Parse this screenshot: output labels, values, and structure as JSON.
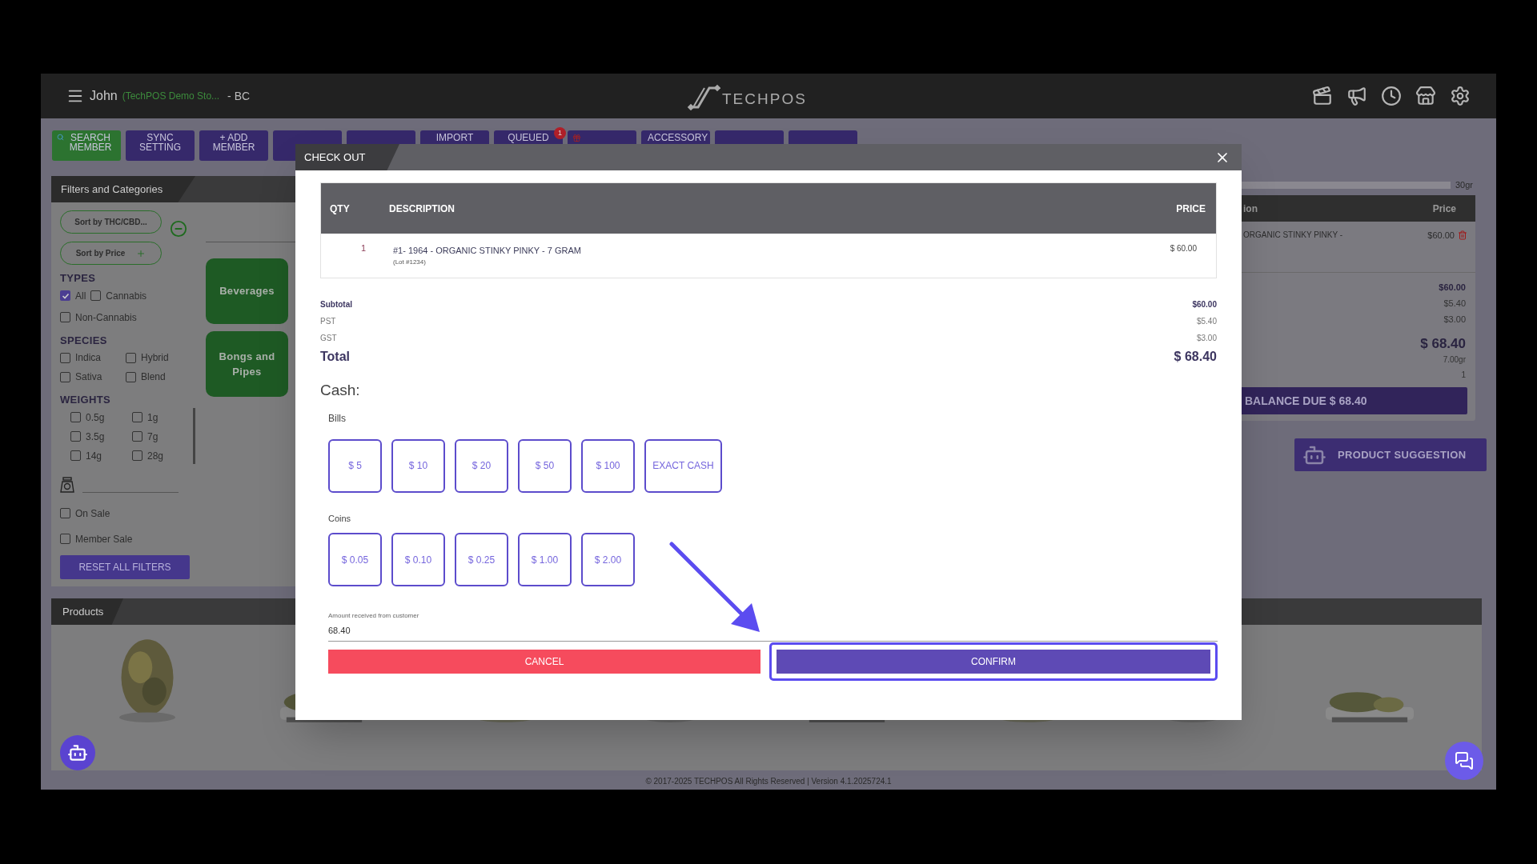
{
  "top_bar": {
    "user": "John",
    "store": "(TechPOS Demo Sto...",
    "region": "- BC",
    "logo": "TECHPOS"
  },
  "toolbar": [
    {
      "label": "SEARCH MEMBER",
      "kind": "search"
    },
    {
      "label": "SYNC SETTING",
      "kind": "action"
    },
    {
      "label": "+ ADD MEMBER",
      "kind": "action"
    },
    {
      "kind": "action"
    },
    {
      "kind": "action"
    },
    {
      "label": "IMPORT",
      "kind": "action"
    },
    {
      "label": "QUEUED",
      "kind": "action",
      "badge": "1"
    },
    {
      "kind": "gift"
    },
    {
      "label": "ACCESSORY",
      "kind": "action"
    },
    {
      "kind": "action"
    },
    {
      "kind": "action"
    }
  ],
  "filters": {
    "title": "Filters and Categories",
    "sort_buttons": [
      {
        "label": "Sort by THC/CBD...",
        "kind": "plain"
      },
      {
        "label": "Sort by Price",
        "kind": "add"
      }
    ],
    "sections": [
      {
        "title": "TYPES",
        "kind": "wrap",
        "options": [
          {
            "label": "All",
            "checked": true
          },
          {
            "label": "Cannabis",
            "checked": false
          },
          {
            "label": "Non-Cannabis",
            "checked": false
          }
        ]
      },
      {
        "title": "SPECIES",
        "kind": "grid",
        "options": [
          {
            "label": "Indica",
            "checked": false
          },
          {
            "label": "Hybrid",
            "checked": false
          },
          {
            "label": "Sativa",
            "checked": false
          },
          {
            "label": "Blend",
            "checked": false
          }
        ]
      },
      {
        "title": "WEIGHTS",
        "kind": "scroll",
        "options": [
          {
            "label": "0.5g",
            "checked": false
          },
          {
            "label": "1g",
            "checked": false
          },
          {
            "label": "3.5g",
            "checked": false
          },
          {
            "label": "7g",
            "checked": false
          },
          {
            "label": "14g",
            "checked": false
          },
          {
            "label": "28g",
            "checked": false
          }
        ]
      }
    ],
    "toggles": [
      {
        "label": "On Sale",
        "checked": false
      },
      {
        "label": "Member Sale",
        "checked": false
      }
    ],
    "reset": "RESET ALL FILTERS"
  },
  "categories": [
    {
      "label": "Beverages"
    },
    {
      "label": "Bongs and Pipes"
    }
  ],
  "products": {
    "title": "Products"
  },
  "cart": {
    "weight_limit": "30gr",
    "columns": [
      "ion",
      "Price"
    ],
    "items": [
      {
        "description": "ORGANIC STINKY PINKY -",
        "price": "$60.00"
      }
    ],
    "totals": [
      {
        "value": "$60.00",
        "kind": "bold"
      },
      {
        "value": "$5.40",
        "kind": "plain"
      },
      {
        "value": "$3.00",
        "kind": "plain"
      },
      {
        "value": "$ 68.40",
        "kind": "big"
      },
      {
        "value": "7.00gr",
        "kind": "small"
      },
      {
        "value": "1",
        "kind": "small"
      }
    ],
    "balance": "BALANCE DUE $ 68.40",
    "suggestion": "PRODUCT SUGGESTION"
  },
  "checkout": {
    "title": "CHECK OUT",
    "columns": [
      "QTY",
      "DESCRIPTION",
      "PRICE"
    ],
    "items": [
      {
        "qty": "1",
        "description": "#1- 1964 - ORGANIC STINKY PINKY - 7 GRAM",
        "lot": "(Lot #1234)",
        "price": "$ 60.00"
      }
    ],
    "summary": [
      {
        "label": "Subtotal",
        "value": "$60.00",
        "kind": "subtotal"
      },
      {
        "label": "PST",
        "value": "$5.40",
        "kind": "tax"
      },
      {
        "label": "GST",
        "value": "$3.00",
        "kind": "tax"
      },
      {
        "label": "Total",
        "value": "$ 68.40",
        "kind": "total"
      }
    ],
    "payment_title": "Cash:",
    "bills_label": "Bills",
    "bills": [
      {
        "label": "$ 5",
        "kind": "bill"
      },
      {
        "label": "$ 10",
        "kind": "bill"
      },
      {
        "label": "$ 20",
        "kind": "bill"
      },
      {
        "label": "$ 50",
        "kind": "bill"
      },
      {
        "label": "$ 100",
        "kind": "bill"
      },
      {
        "label": "EXACT CASH",
        "kind": "exact"
      }
    ],
    "coins_label": "Coins",
    "coins": [
      "$ 0.05",
      "$ 0.10",
      "$ 0.25",
      "$ 1.00",
      "$ 2.00"
    ],
    "amount_label": "Amount received from customer",
    "amount": "68.40",
    "cancel": "CANCEL",
    "confirm": "CONFIRM",
    "confirm_highlighted": true
  },
  "footer": "© 2017-2025 TECHPOS All Rights Reserved | Version 4.1.2025724.1"
}
